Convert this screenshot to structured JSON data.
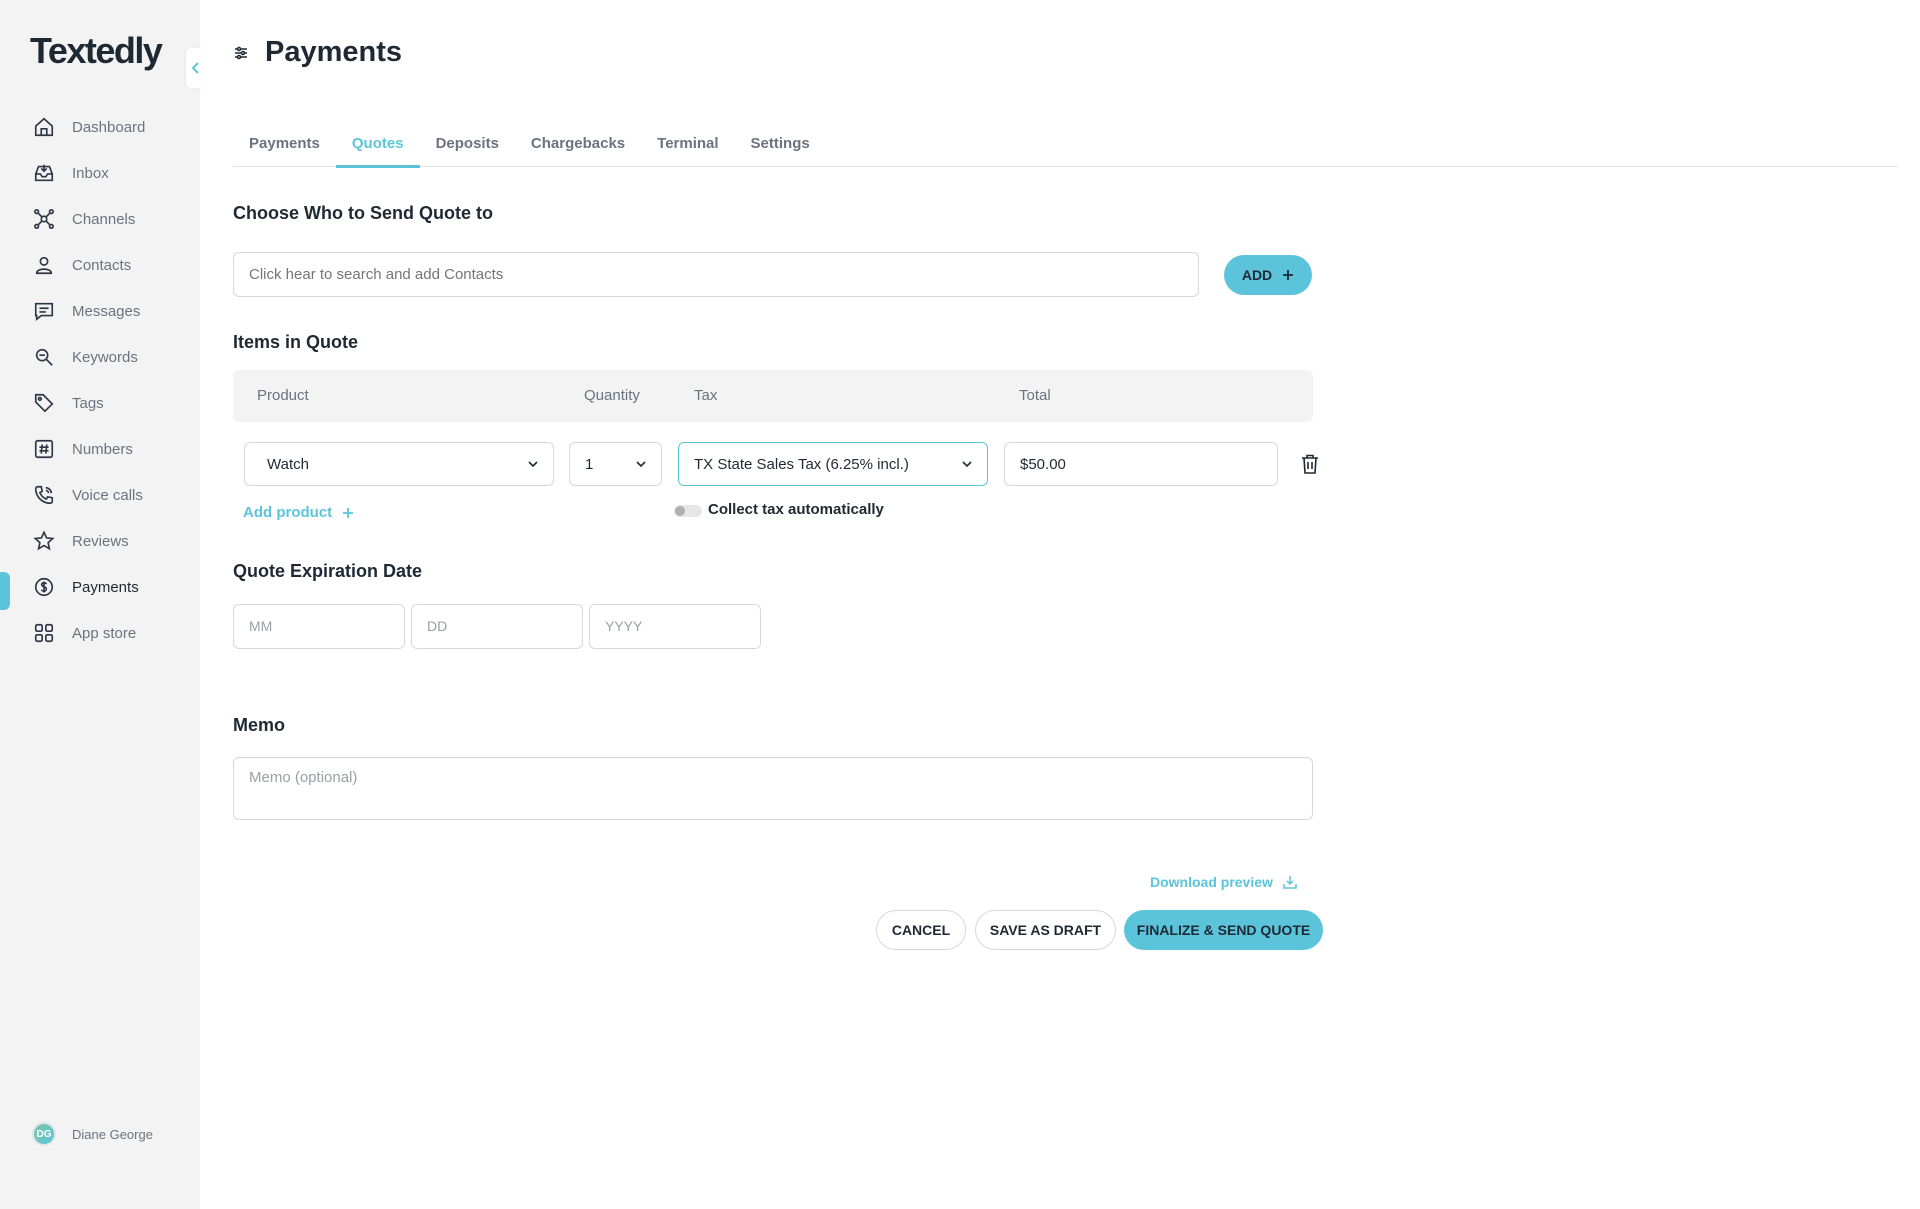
{
  "app": {
    "logo": "Textedly"
  },
  "sidebar": {
    "items": [
      {
        "label": "Dashboard",
        "icon": "home-icon"
      },
      {
        "label": "Inbox",
        "icon": "inbox-icon"
      },
      {
        "label": "Channels",
        "icon": "channels-icon"
      },
      {
        "label": "Contacts",
        "icon": "contact-icon"
      },
      {
        "label": "Messages",
        "icon": "message-icon"
      },
      {
        "label": "Keywords",
        "icon": "keyword-icon"
      },
      {
        "label": "Tags",
        "icon": "tag-icon"
      },
      {
        "label": "Numbers",
        "icon": "hash-icon"
      },
      {
        "label": "Voice calls",
        "icon": "phone-icon"
      },
      {
        "label": "Reviews",
        "icon": "star-icon"
      },
      {
        "label": "Payments",
        "icon": "dollar-icon",
        "active": true
      },
      {
        "label": "App store",
        "icon": "grid-icon"
      }
    ],
    "user": {
      "initials": "DG",
      "name": "Diane George"
    }
  },
  "header": {
    "title": "Payments"
  },
  "tabs": [
    "Payments",
    "Quotes",
    "Deposits",
    "Chargebacks",
    "Terminal",
    "Settings"
  ],
  "active_tab": "Quotes",
  "recipient": {
    "title": "Choose Who to Send Quote to",
    "placeholder": "Click hear to search and add Contacts",
    "add_label": "ADD"
  },
  "items": {
    "title": "Items in Quote",
    "columns": {
      "product": "Product",
      "quantity": "Quantity",
      "tax": "Tax",
      "total": "Total"
    },
    "row": {
      "product": "Watch",
      "quantity": "1",
      "tax": "TX State Sales Tax (6.25% incl.)",
      "total": "$50.00"
    },
    "add_product_label": "Add product",
    "collect_tax_label": "Collect tax automatically",
    "collect_tax_enabled": false
  },
  "expiration": {
    "title": "Quote Expiration Date",
    "mm_placeholder": "MM",
    "dd_placeholder": "DD",
    "yyyy_placeholder": "YYYY"
  },
  "memo": {
    "title": "Memo",
    "placeholder": "Memo (optional)"
  },
  "actions": {
    "download_preview": "Download preview",
    "cancel": "CANCEL",
    "save_draft": "SAVE AS DRAFT",
    "finalize": "FINALIZE & SEND QUOTE"
  },
  "colors": {
    "accent": "#5bc4db",
    "sidebar_bg": "#f3f3f3",
    "text_dark": "#1f2933",
    "text_muted": "#6b7280"
  }
}
